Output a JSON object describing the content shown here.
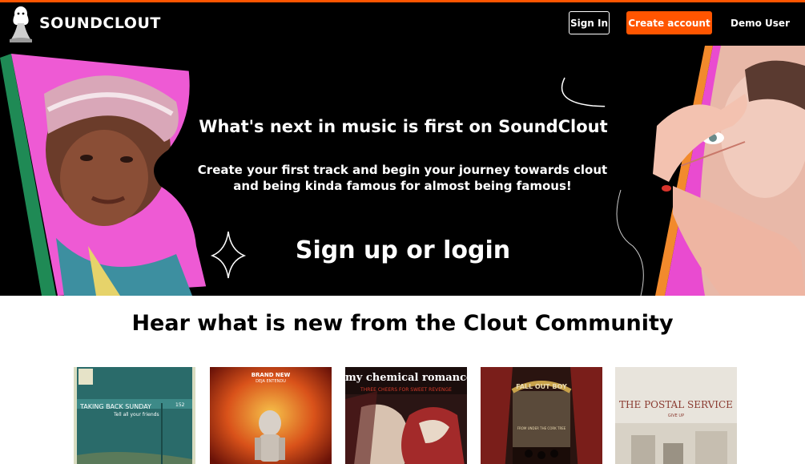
{
  "header": {
    "logo_text": "SOUNDCLOUT",
    "sign_in_label": "Sign In",
    "create_account_label": "Create account",
    "user_label": "Demo User"
  },
  "hero": {
    "title": "What's next in music is first on SoundClout",
    "subtitle_line1": "Create your first track and begin your journey towards clout",
    "subtitle_line2": "and being kinda famous for almost being famous!",
    "cta_label": "Sign up or login"
  },
  "community": {
    "title": "Hear what is new from the Clout Community",
    "albums": [
      {
        "artist": "TAKING BACK SUNDAY",
        "subtitle": "Tell all your friends",
        "badge": "152",
        "colors": [
          "#2a6b6a",
          "#c9d0a8"
        ]
      },
      {
        "artist": "BRAND NEW",
        "subtitle": "DEJA ENTENDU",
        "colors": [
          "#b8240c",
          "#f39a1e"
        ]
      },
      {
        "artist": "my chemical romance.",
        "subtitle": "THREE CHEERS FOR SWEET REVENGE",
        "colors": [
          "#1a0d0c",
          "#a32a2a"
        ]
      },
      {
        "artist": "FALL OUT BOY",
        "subtitle": "FROM UNDER THE CORK TREE",
        "colors": [
          "#3a1a14",
          "#8a6a3a"
        ]
      },
      {
        "artist": "THE POSTAL SERVICE",
        "subtitle": "GIVE UP",
        "colors": [
          "#e8e4dc",
          "#8a3a30"
        ]
      }
    ]
  },
  "theme": {
    "accent": "#ff5500",
    "header_bg": "#000000",
    "hero_pink": "#ee5ad4",
    "hero_green": "#1f8a55",
    "hero_orange": "#f28a2c"
  }
}
